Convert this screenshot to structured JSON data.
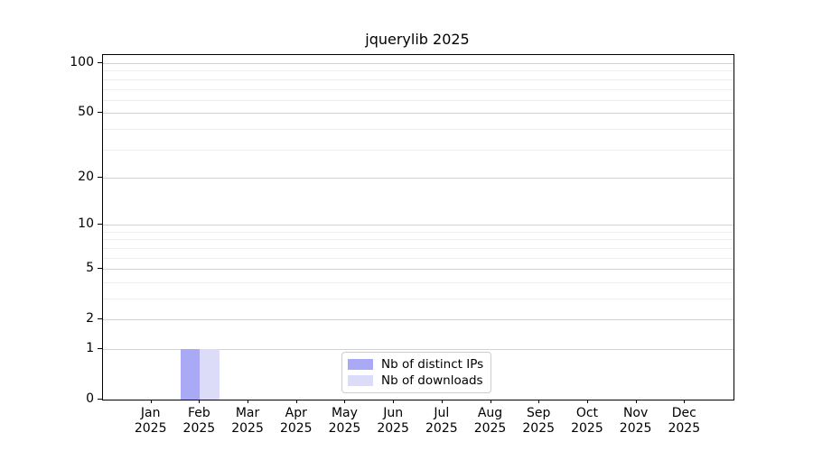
{
  "chart_data": {
    "type": "bar",
    "title": "jquerylib 2025",
    "xlabel": "",
    "ylabel": "",
    "year_label": "2025",
    "months": [
      "Jan",
      "Feb",
      "Mar",
      "Apr",
      "May",
      "Jun",
      "Jul",
      "Aug",
      "Sep",
      "Oct",
      "Nov",
      "Dec"
    ],
    "series": [
      {
        "name": "Nb of distinct IPs",
        "color": "#a9a9f6",
        "values": [
          0,
          1,
          0,
          0,
          0,
          0,
          0,
          0,
          0,
          0,
          0,
          0
        ]
      },
      {
        "name": "Nb of downloads",
        "color": "#dcdcf8",
        "values": [
          0,
          1,
          0,
          0,
          0,
          0,
          0,
          0,
          0,
          0,
          0,
          0
        ]
      }
    ],
    "yscale": "log1p",
    "ylim": [
      0,
      112
    ],
    "yticks": [
      0,
      1,
      2,
      5,
      10,
      20,
      50,
      100
    ],
    "minor_yticks": [
      3,
      4,
      6,
      7,
      8,
      9,
      30,
      40,
      60,
      70,
      80,
      90
    ],
    "grid": {
      "major_color": "#d2d2d2",
      "minor_color": "#ededed"
    },
    "legend": {
      "position": "lower center"
    }
  }
}
